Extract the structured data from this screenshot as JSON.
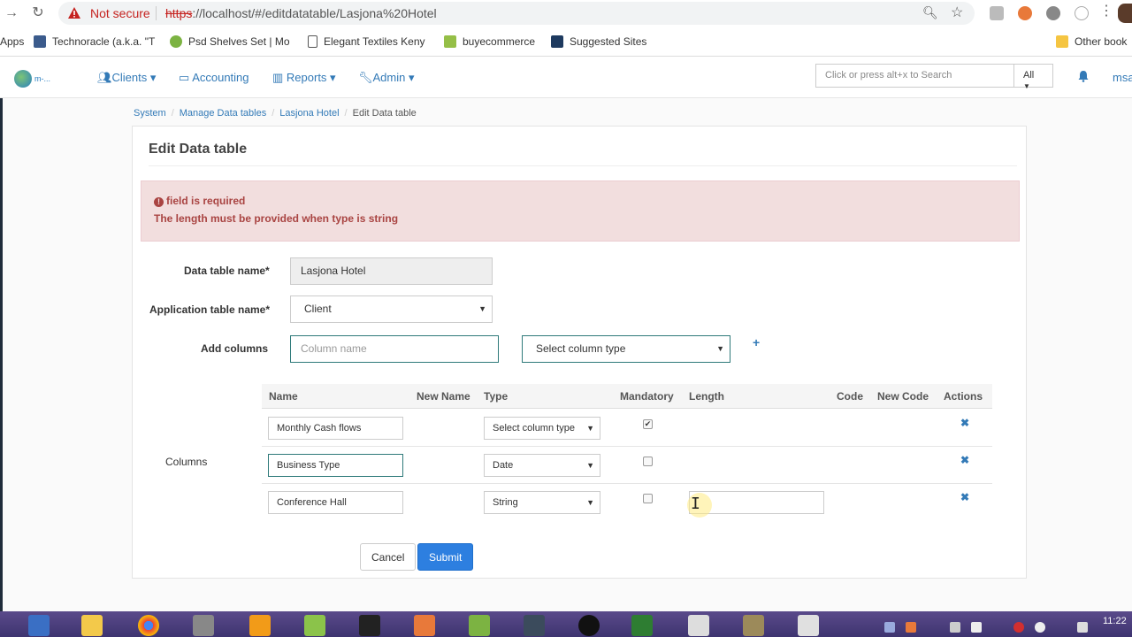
{
  "browser": {
    "security_label": "Not secure",
    "url_scheme": "https",
    "url_rest": "://localhost/#/editdatatable/Lasjona%20Hotel",
    "bookmarks": [
      {
        "label": "Apps"
      },
      {
        "label": "Technoracle (a.k.a. \"T"
      },
      {
        "label": "Psd Shelves Set | Mo"
      },
      {
        "label": "Elegant Textiles Keny"
      },
      {
        "label": "buyecommerce"
      },
      {
        "label": "Suggested Sites"
      },
      {
        "label": "Other book"
      }
    ]
  },
  "navbar": {
    "logo_text": "m-...",
    "clients": "Clients ▾",
    "accounting": "Accounting",
    "reports": "Reports ▾",
    "admin": "Admin ▾",
    "search_placeholder": "Click or press alt+x to Search",
    "search_scope": "All",
    "user": "msa"
  },
  "breadcrumb": {
    "items": [
      "System",
      "Manage Data tables",
      "Lasjona Hotel"
    ],
    "current": "Edit Data table"
  },
  "form": {
    "title": "Edit Data table",
    "errors": [
      "field is required",
      "The length must be provided when type is string"
    ],
    "datatable_name_label": "Data table name*",
    "datatable_name_value": "Lasjona Hotel",
    "app_table_label": "Application table name*",
    "app_table_value": "Client",
    "add_columns_label": "Add columns",
    "column_name_placeholder": "Column name",
    "column_type_placeholder": "Select column type",
    "columns_label": "Columns",
    "headers": [
      "Name",
      "New Name",
      "Type",
      "Mandatory",
      "Length",
      "Code",
      "New Code",
      "Actions"
    ],
    "rows": [
      {
        "name": "Monthly Cash flows",
        "type": "Select column type",
        "mandatory": true
      },
      {
        "name": "Business Type",
        "type": "Date",
        "mandatory": false
      },
      {
        "name": "Conference Hall",
        "type": "String",
        "mandatory": false
      }
    ],
    "cancel_label": "Cancel",
    "submit_label": "Submit"
  },
  "taskbar": {
    "clock": "11:22"
  },
  "colors": {
    "accent": "#337ab7",
    "error_bg": "#f2dede",
    "error_text": "#a94442",
    "submit": "#2d7fe0"
  }
}
